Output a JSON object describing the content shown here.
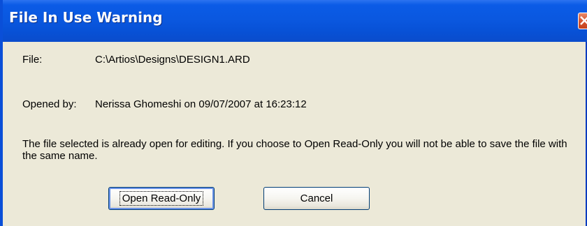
{
  "window": {
    "title": "File In Use Warning"
  },
  "fields": {
    "file_label": "File:",
    "file_value": "C:\\Artios\\Designs\\DESIGN1.ARD",
    "opened_by_label": "Opened by:",
    "opened_by_value": "Nerissa Ghomeshi on 09/07/2007 at 16:23:12"
  },
  "message": "The file selected is already open for editing.  If you choose to Open Read-Only you will not be able to save the file with the same name.",
  "buttons": {
    "open_read_only": "Open Read-Only",
    "cancel": "Cancel"
  },
  "colors": {
    "titlebar": "#0a58e0",
    "body": "#ece9d8",
    "close": "#d5542f"
  }
}
